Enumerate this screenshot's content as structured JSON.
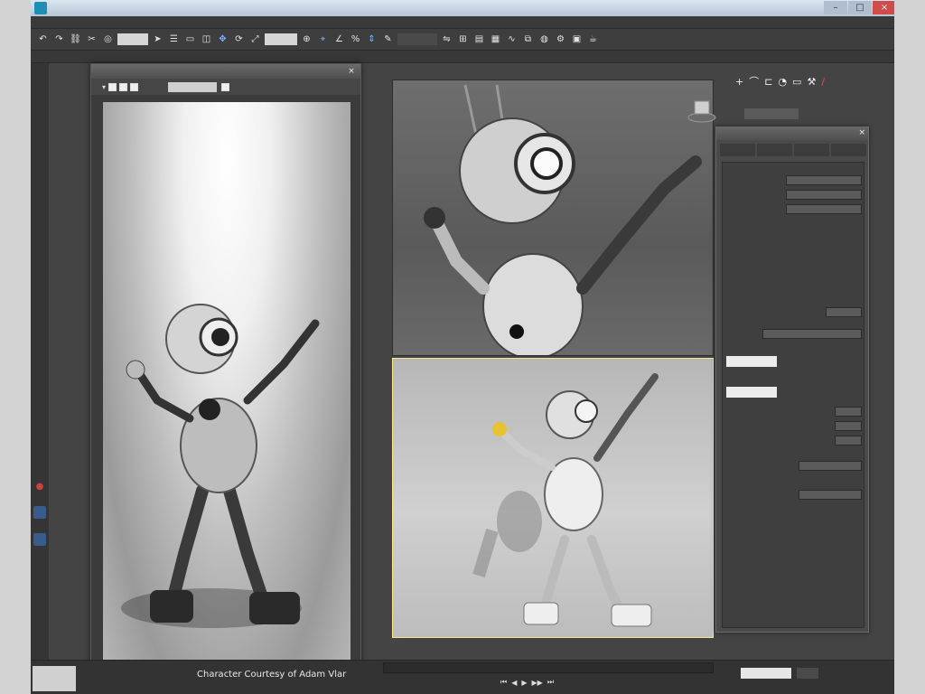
{
  "colors": {
    "app_background": "#444444",
    "accent_blue": "#7fb4ff",
    "active_viewport_border": "#ffe48a",
    "close_red": "#e24a4a"
  },
  "caption": "Character Courtesy of Adam Vlar",
  "icons": {
    "toolbar": [
      "undo-icon",
      "redo-icon",
      "link-icon",
      "unlink-icon",
      "bind-icon",
      "selection-filter-field",
      "select-icon",
      "select-by-name-icon",
      "rect-select-icon",
      "window-crossing-icon",
      "move-icon",
      "rotate-icon",
      "scale-icon",
      "reference-field",
      "pivot-icon",
      "snap-icon",
      "angle-snap-icon",
      "percent-snap-icon",
      "spinner-snap-icon",
      "named-selection-field",
      "mirror-icon",
      "align-icon",
      "layer-icon",
      "ribbon-icon",
      "curve-editor-icon",
      "schematic-icon",
      "material-editor-icon",
      "render-setup-icon",
      "render-frame-icon",
      "render-icon"
    ],
    "command_panel": [
      "create-icon",
      "modify-icon",
      "hierarchy-icon",
      "motion-icon",
      "display-icon",
      "utilities-icon"
    ]
  },
  "playback": {
    "controls": [
      "⏮",
      "◀",
      "▶",
      "▶▶",
      "⏭"
    ]
  }
}
